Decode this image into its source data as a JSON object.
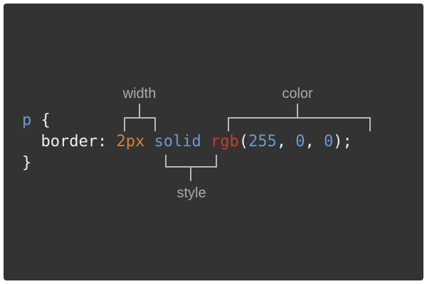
{
  "code": {
    "line1": {
      "selector": "p",
      "brace_open": " {"
    },
    "line2": {
      "indent": "  ",
      "property": "border",
      "colon": ": ",
      "width_value": "2px",
      "space1": " ",
      "style_value": "solid",
      "space2": " ",
      "color_func": "rgb",
      "paren_open": "(",
      "r": "255",
      "sep1": ", ",
      "g": "0",
      "sep2": ", ",
      "b": "0",
      "paren_close_semi": ");"
    },
    "line3": {
      "brace_close": "}"
    }
  },
  "annotations": {
    "width": "width",
    "color": "color",
    "style": "style"
  },
  "colors": {
    "background": "#333333",
    "selector": "#6a9ad1",
    "width_value": "#d57f3f",
    "style_value": "#6a9ad1",
    "color_function": "#cf3a2a",
    "numbers": "#6a9ad1",
    "annotation": "#a9a9a9",
    "bracket": "#b7b7b7"
  }
}
